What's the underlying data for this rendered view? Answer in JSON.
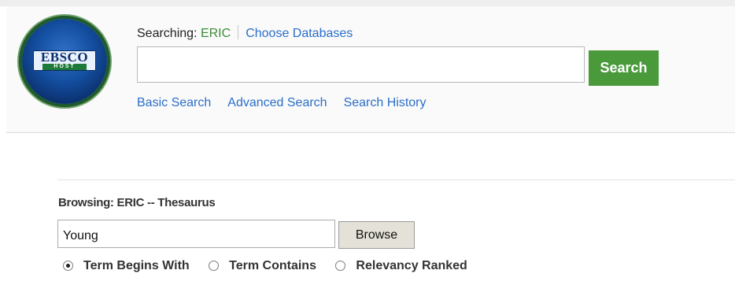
{
  "header": {
    "logo": {
      "brand": "EBSCO",
      "sub": "HOST"
    },
    "searching_label": "Searching:",
    "database": "ERIC",
    "choose_databases": "Choose Databases",
    "search_value": "",
    "search_button": "Search",
    "links": [
      "Basic Search",
      "Advanced Search",
      "Search History"
    ]
  },
  "browse": {
    "title": "Browsing: ERIC -- Thesaurus",
    "input_value": "Young",
    "button": "Browse",
    "options": [
      {
        "label": "Term Begins With",
        "checked": true
      },
      {
        "label": "Term Contains",
        "checked": false
      },
      {
        "label": "Relevancy Ranked",
        "checked": false
      }
    ]
  },
  "colors": {
    "link": "#2a6ec9",
    "accent_green": "#4a9a3c",
    "database_green": "#3d8b37"
  }
}
